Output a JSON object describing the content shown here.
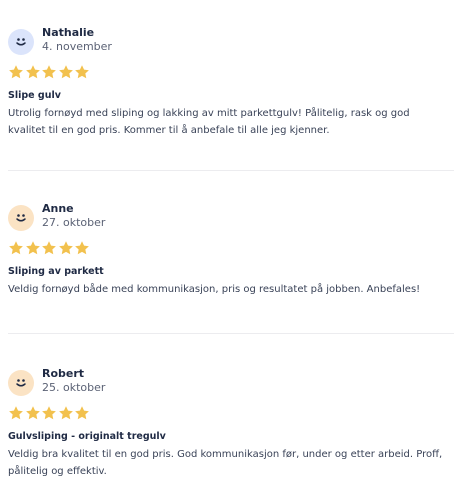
{
  "colors": {
    "star": "#f2c14e",
    "avatar_blue": "#dbe4fb",
    "avatar_peach": "#fbe3c4"
  },
  "reviews": [
    {
      "name": "Nathalie",
      "date": "4. november",
      "rating": 5,
      "avatar_icon": "smiley-face-icon",
      "avatar_color": "#dbe4fb",
      "title": "Slipe gulv",
      "lines": [
        "Utrolig fornøyd med sliping og lakking av mitt parkettgulv! Pålitelig, rask og god",
        "kvalitet til en god pris. Kommer til å anbefale til alle jeg kjenner."
      ]
    },
    {
      "name": "Anne",
      "date": "27. oktober",
      "rating": 5,
      "avatar_icon": "smiley-face-icon",
      "avatar_color": "#fbe3c4",
      "title": "Sliping av parkett",
      "lines": [
        "Veldig fornøyd både med kommunikasjon, pris og resultatet på jobben. Anbefales!"
      ]
    },
    {
      "name": "Robert",
      "date": "25. oktober",
      "rating": 5,
      "avatar_icon": "smiley-face-icon",
      "avatar_color": "#fbe3c4",
      "title": "Gulvsliping - originalt tregulv",
      "lines": [
        "Veldig bra kvalitet til en god pris. God kommunikasjon før, under og etter arbeid. Proff,",
        "pålitelig og effektiv."
      ]
    }
  ]
}
